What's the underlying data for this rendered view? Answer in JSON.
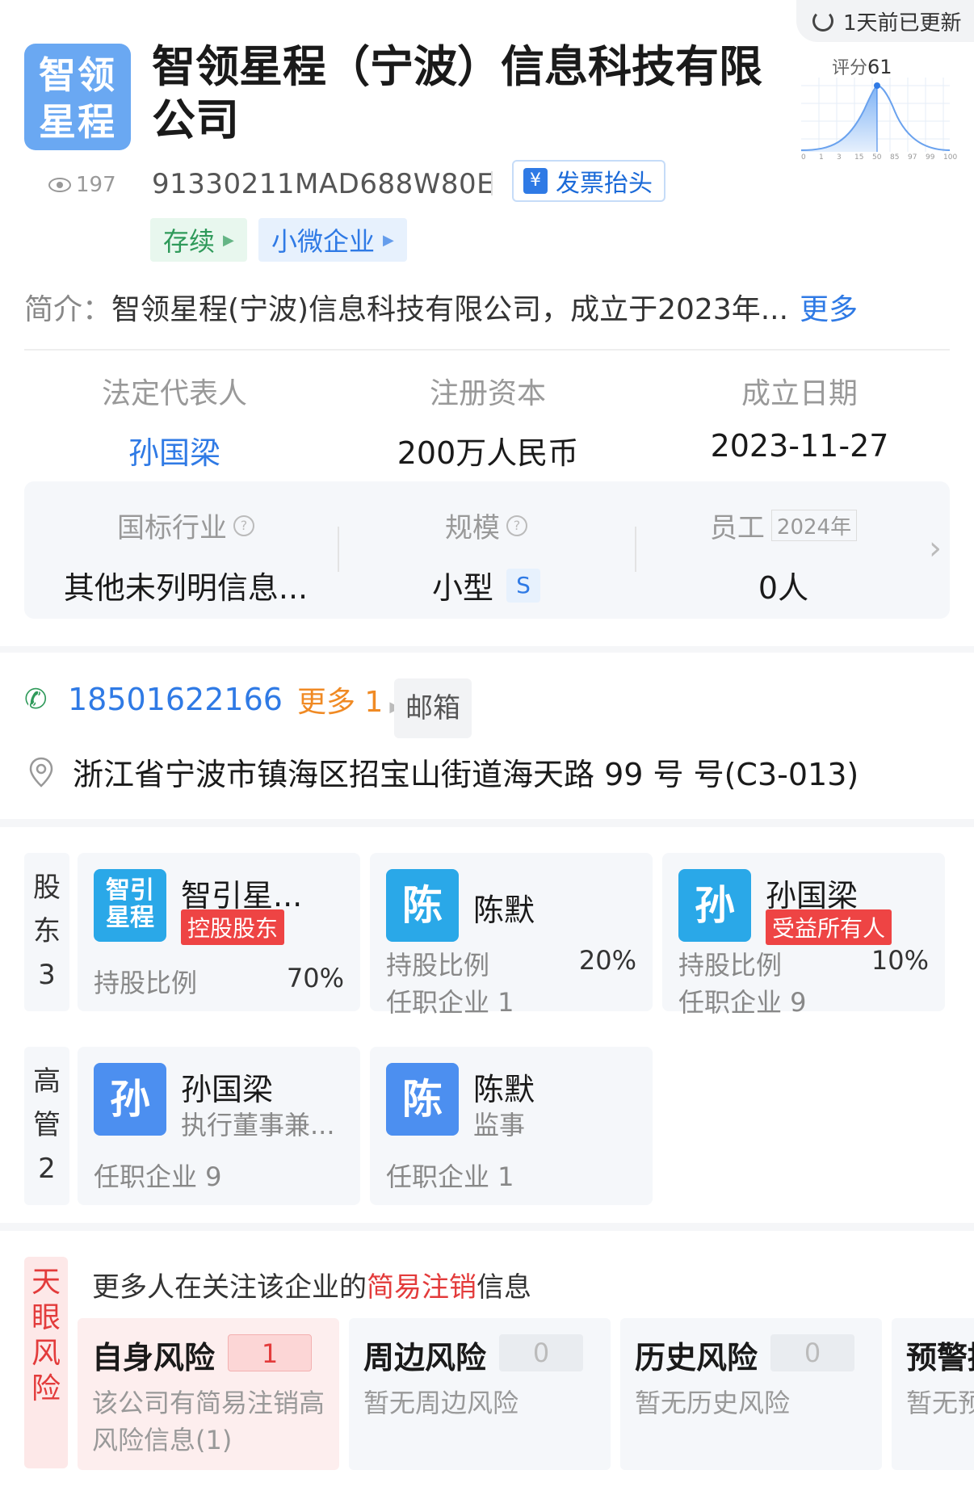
{
  "header": {
    "update_status": "1天前已更新",
    "logo_text_line1": "智领",
    "logo_text_line2": "星程",
    "view_count": "197",
    "company_name": "智领星程（宁波）信息科技有限公司",
    "credit_code": "91330211MAD688W80E",
    "invoice_button": "发票抬头",
    "invoice_icon_glyph": "¥",
    "tags": [
      "存续",
      "小微企业"
    ],
    "score_label": "评分",
    "score_value": "61",
    "score_axis": [
      "0",
      "1",
      "3",
      "15",
      "50",
      "85",
      "97",
      "99",
      "100"
    ]
  },
  "intro": {
    "label": "简介：",
    "text": "智领星程(宁波)信息科技有限公司，成立于2023年...",
    "more": "更多"
  },
  "stats": [
    {
      "label": "法定代表人",
      "value": "孙国梁"
    },
    {
      "label": "注册资本",
      "value": "200万人民币"
    },
    {
      "label": "成立日期",
      "value": "2023-11-27"
    }
  ],
  "info": {
    "industry_label": "国标行业",
    "industry_value": "其他未列明信息...",
    "scale_label": "规模",
    "scale_value": "小型",
    "scale_badge": "S",
    "staff_label": "员工",
    "staff_year": "2024年",
    "staff_value": "0人"
  },
  "contact": {
    "phone": "18501622166",
    "more_phone": "更多 1",
    "email_button": "邮箱",
    "address": "浙江省宁波市镇海区招宝山街道海天路 99 号 号(C3-013)"
  },
  "shareholders": {
    "side_label": [
      "股",
      "东",
      "3"
    ],
    "items": [
      {
        "avatar_line1": "智引",
        "avatar_line2": "星程",
        "name": "智引星...",
        "badge": "控股股东",
        "ratio_label": "持股比例",
        "ratio": "70%"
      },
      {
        "avatar": "陈",
        "name": "陈默",
        "ratio_label": "持股比例",
        "ratio": "20%",
        "companies": "任职企业 1"
      },
      {
        "avatar": "孙",
        "name": "孙国梁",
        "badge": "受益所有人",
        "ratio_label": "持股比例",
        "ratio": "10%",
        "companies": "任职企业 9"
      }
    ]
  },
  "executives": {
    "side_label": [
      "高",
      "管",
      "2"
    ],
    "items": [
      {
        "avatar": "孙",
        "name": "孙国梁",
        "role": "执行董事兼...",
        "companies": "任职企业 9"
      },
      {
        "avatar": "陈",
        "name": "陈默",
        "role": "监事",
        "companies": "任职企业 1"
      }
    ]
  },
  "risk": {
    "side_label": [
      "天",
      "眼",
      "风",
      "险"
    ],
    "headline_prefix": "更多人在关注该企业的",
    "headline_highlight": "简易注销",
    "headline_suffix": "信息",
    "cards": [
      {
        "title": "自身风险",
        "count": "1",
        "desc": "该公司有简易注销高风险信息(1)"
      },
      {
        "title": "周边风险",
        "count": "0",
        "desc": "暂无周边风险"
      },
      {
        "title": "历史风险",
        "count": "0",
        "desc": "暂无历史风险"
      },
      {
        "title": "预警提",
        "desc": "暂无预"
      }
    ]
  },
  "colors": {
    "accent": "#2f7ae5",
    "risk": "#e33b3b",
    "green": "#2f9a5a",
    "orange": "#f08a24"
  }
}
